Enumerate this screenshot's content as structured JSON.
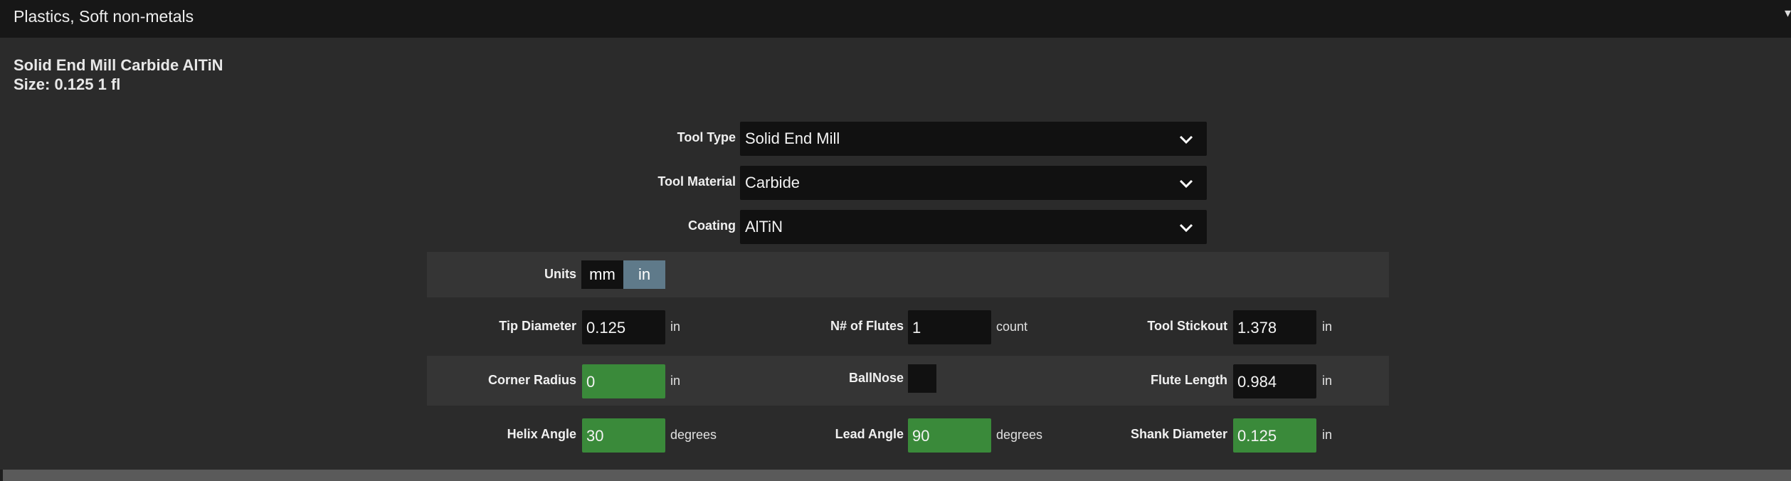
{
  "header": {
    "material": "Plastics, Soft non-metals",
    "caret": "▾"
  },
  "tool": {
    "name": "Solid End Mill Carbide AlTiN",
    "size": "Size: 0.125 1 fl"
  },
  "selects": {
    "tool_type": {
      "label": "Tool Type",
      "value": "Solid End Mill"
    },
    "tool_material": {
      "label": "Tool Material",
      "value": "Carbide"
    },
    "coating": {
      "label": "Coating",
      "value": "AlTiN"
    }
  },
  "units": {
    "label": "Units",
    "options": [
      "mm",
      "in"
    ],
    "selected": "in"
  },
  "params": {
    "tip_diameter": {
      "label": "Tip Diameter",
      "value": "0.125",
      "unit": "in"
    },
    "flutes": {
      "label": "N# of Flutes",
      "value": "1",
      "unit": "count"
    },
    "tool_stickout": {
      "label": "Tool Stickout",
      "value": "1.378",
      "unit": "in"
    },
    "corner_radius": {
      "label": "Corner Radius",
      "value": "0",
      "unit": "in"
    },
    "ballnose": {
      "label": "BallNose",
      "checked": false
    },
    "flute_length": {
      "label": "Flute Length",
      "value": "0.984",
      "unit": "in"
    },
    "helix_angle": {
      "label": "Helix Angle",
      "value": "30",
      "unit": "degrees"
    },
    "lead_angle": {
      "label": "Lead Angle",
      "value": "90",
      "unit": "degrees"
    },
    "shank_diameter": {
      "label": "Shank Diameter",
      "value": "0.125",
      "unit": "in"
    }
  },
  "colors": {
    "background": "#2b2b2b",
    "field_dark": "#111111",
    "field_green": "#3a8a3a",
    "units_selected": "#5f7a8a",
    "band": "#353535"
  },
  "icons": {
    "select_chevron": "chevron-down-icon"
  }
}
